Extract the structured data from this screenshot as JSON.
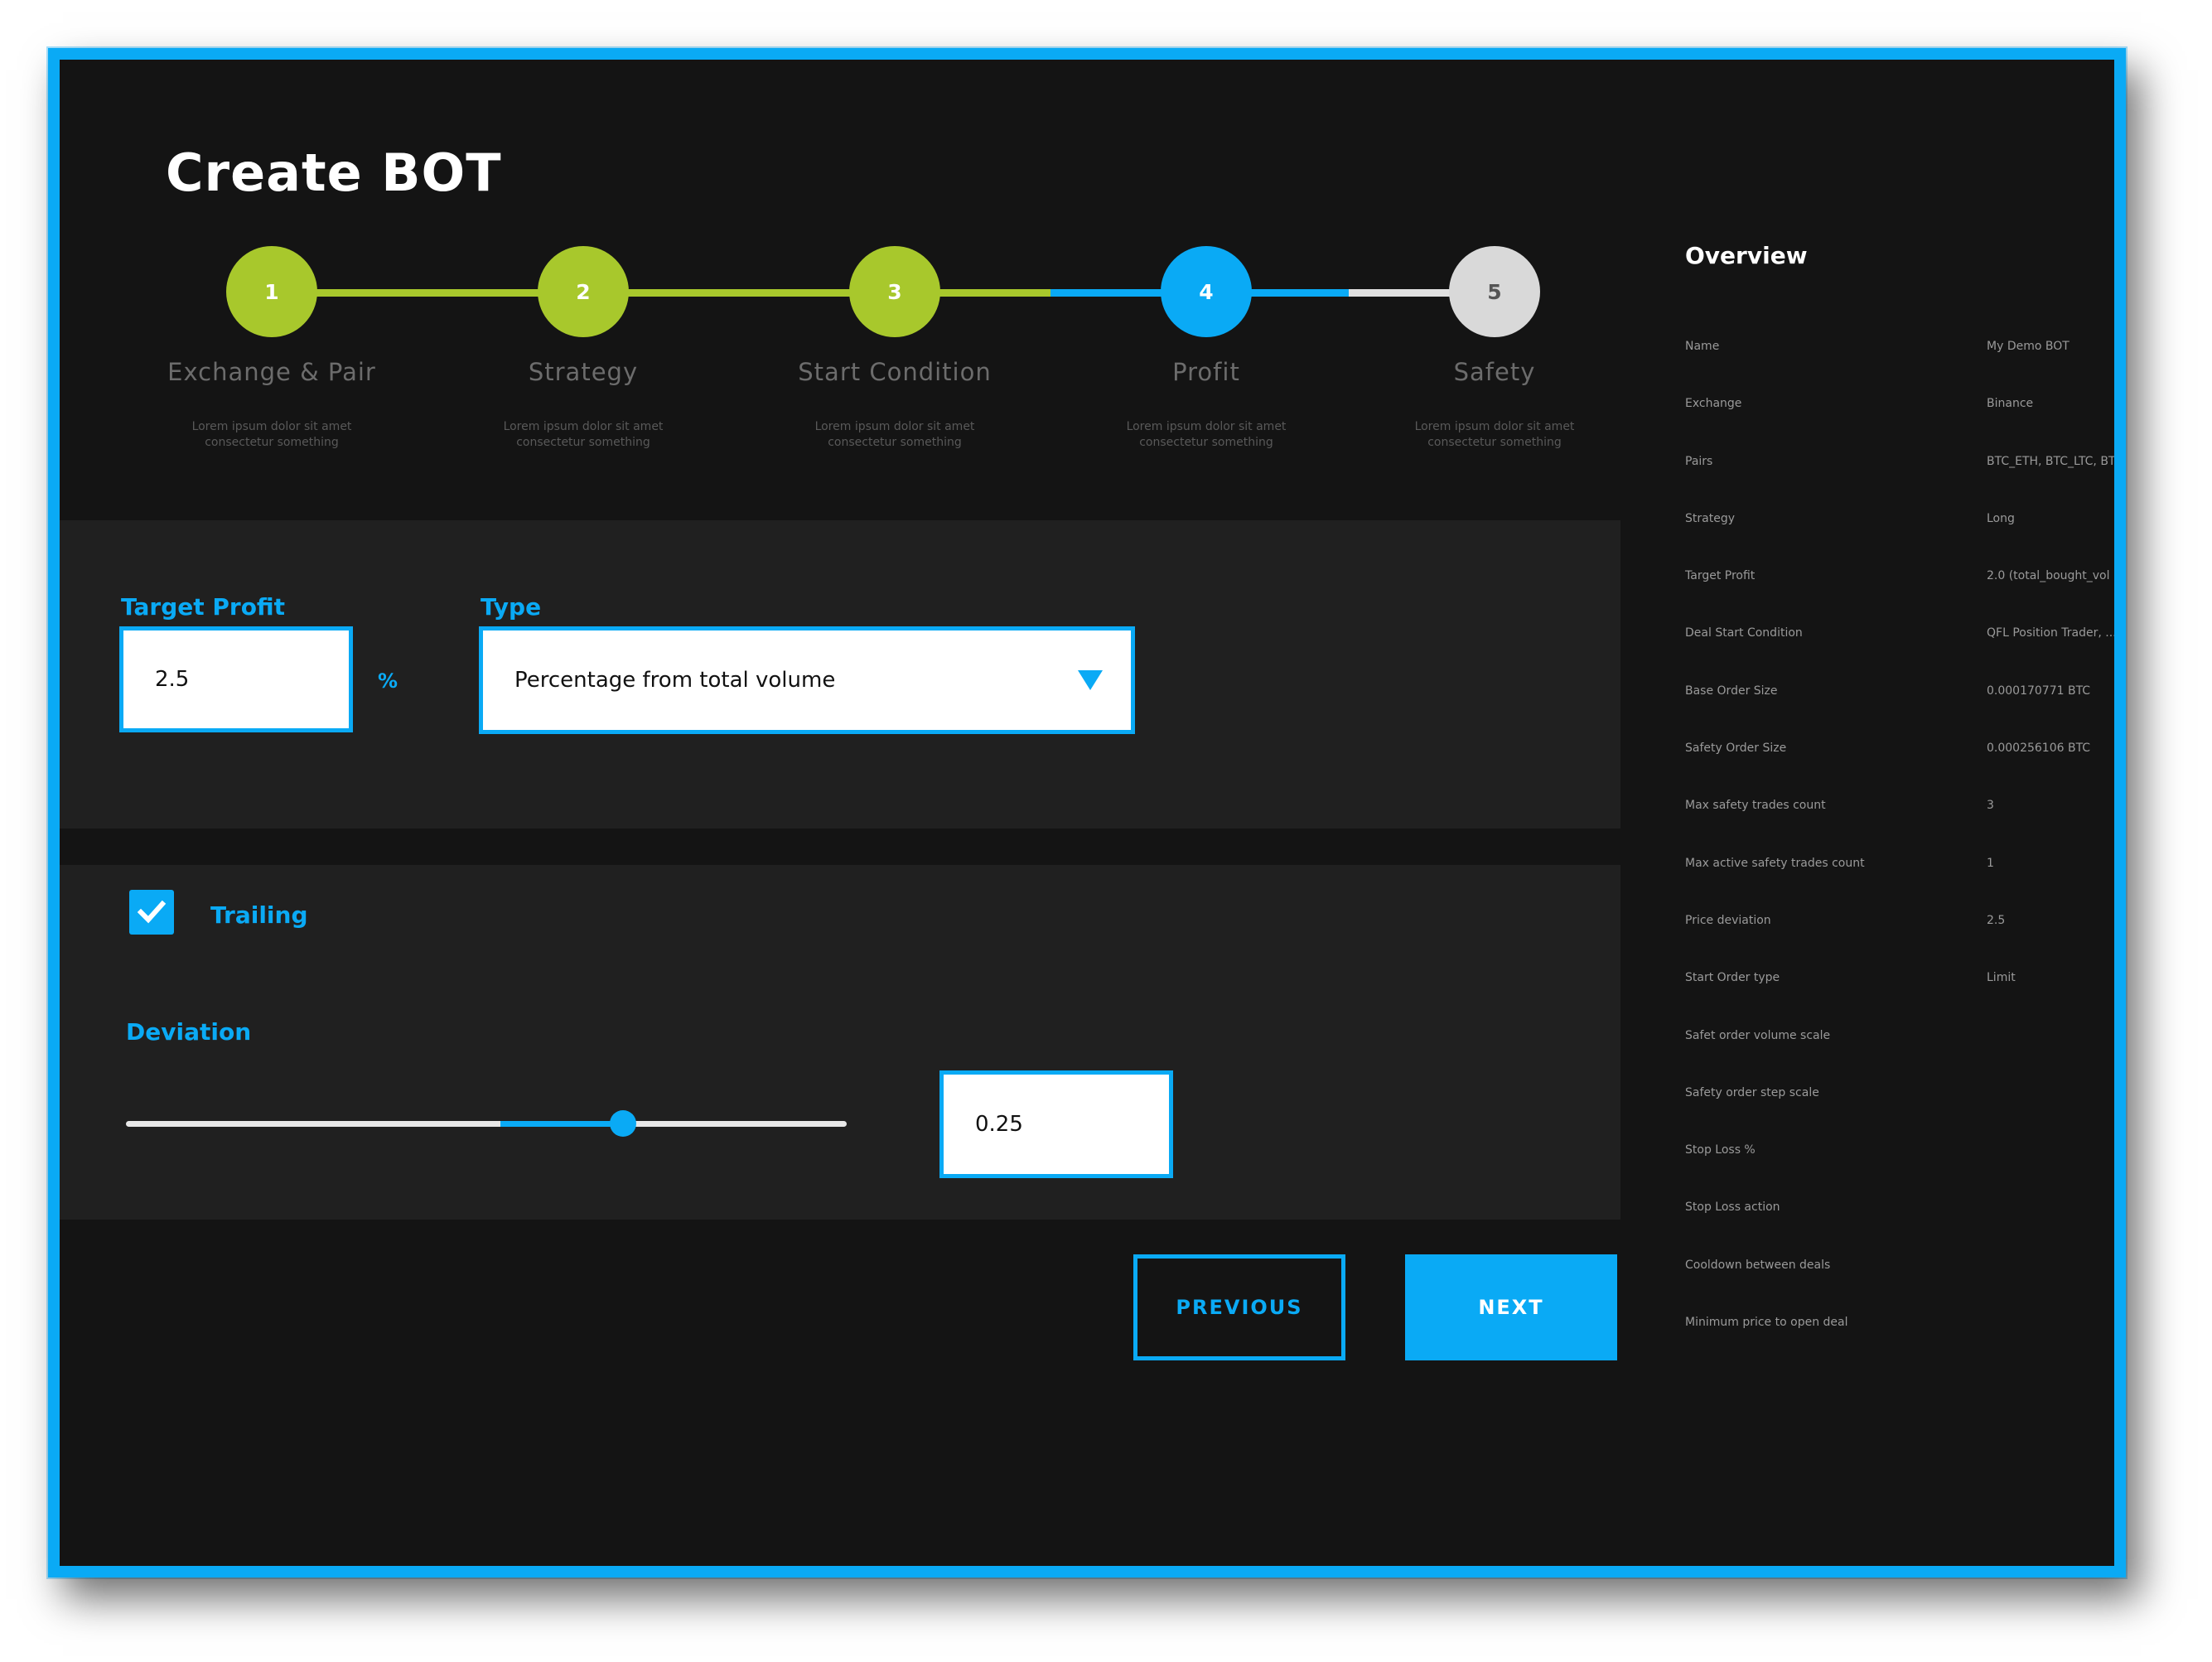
{
  "app": {
    "title": "Create BOT",
    "colors": {
      "accent": "#0aaaf5",
      "complete": "#a8c82c",
      "pending": "#d9d9d9",
      "background": "#141414",
      "panel": "#202020"
    }
  },
  "stepper": {
    "current": 4,
    "steps": [
      {
        "number": "1",
        "label": "Exchange & Pair",
        "description": "Lorem ipsum dolor sit amet consectetur something",
        "status": "complete"
      },
      {
        "number": "2",
        "label": "Strategy",
        "description": "Lorem ipsum dolor sit amet consectetur something",
        "status": "complete"
      },
      {
        "number": "3",
        "label": "Start Condition",
        "description": "Lorem ipsum dolor sit amet consectetur something",
        "status": "complete"
      },
      {
        "number": "4",
        "label": "Profit",
        "description": "Lorem ipsum dolor sit amet consectetur something",
        "status": "current"
      },
      {
        "number": "5",
        "label": "Safety",
        "description": "Lorem ipsum dolor sit amet consectetur something",
        "status": "pending"
      }
    ]
  },
  "profit": {
    "target_label": "Target Profit",
    "target_value": "2.5",
    "target_unit": "%",
    "type_label": "Type",
    "type_value": "Percentage from total volume"
  },
  "trailing": {
    "checkbox_label": "Trailing",
    "checked": true,
    "deviation_label": "Deviation",
    "deviation_value": "0.25",
    "slider_fraction": 0.69
  },
  "actions": {
    "previous_label": "PREVIOUS",
    "next_label": "NEXT"
  },
  "overview": {
    "title": "Overview",
    "rows": [
      {
        "key": "Name",
        "value": "My Demo BOT"
      },
      {
        "key": "Exchange",
        "value": "Binance"
      },
      {
        "key": "Pairs",
        "value": "BTC_ETH, BTC_LTC, BT"
      },
      {
        "key": "Strategy",
        "value": "Long"
      },
      {
        "key": "Target Profit",
        "value": "2.0 (total_bought_vol"
      },
      {
        "key": "Deal Start Condition",
        "value": "QFL Position Trader, ..."
      },
      {
        "key": "Base Order Size",
        "value": "0.000170771 BTC"
      },
      {
        "key": "Safety Order Size",
        "value": "0.000256106 BTC"
      },
      {
        "key": "Max safety trades count",
        "value": "3"
      },
      {
        "key": "Max active safety trades count",
        "value": "1"
      },
      {
        "key": "Price deviation",
        "value": "2.5"
      },
      {
        "key": "Start Order type",
        "value": "Limit"
      },
      {
        "key": "Safet order volume scale",
        "value": ""
      },
      {
        "key": "Safety order step scale",
        "value": ""
      },
      {
        "key": "Stop Loss %",
        "value": ""
      },
      {
        "key": "Stop Loss action",
        "value": ""
      },
      {
        "key": "Cooldown between deals",
        "value": ""
      },
      {
        "key": "Minimum price to open deal",
        "value": ""
      }
    ]
  }
}
